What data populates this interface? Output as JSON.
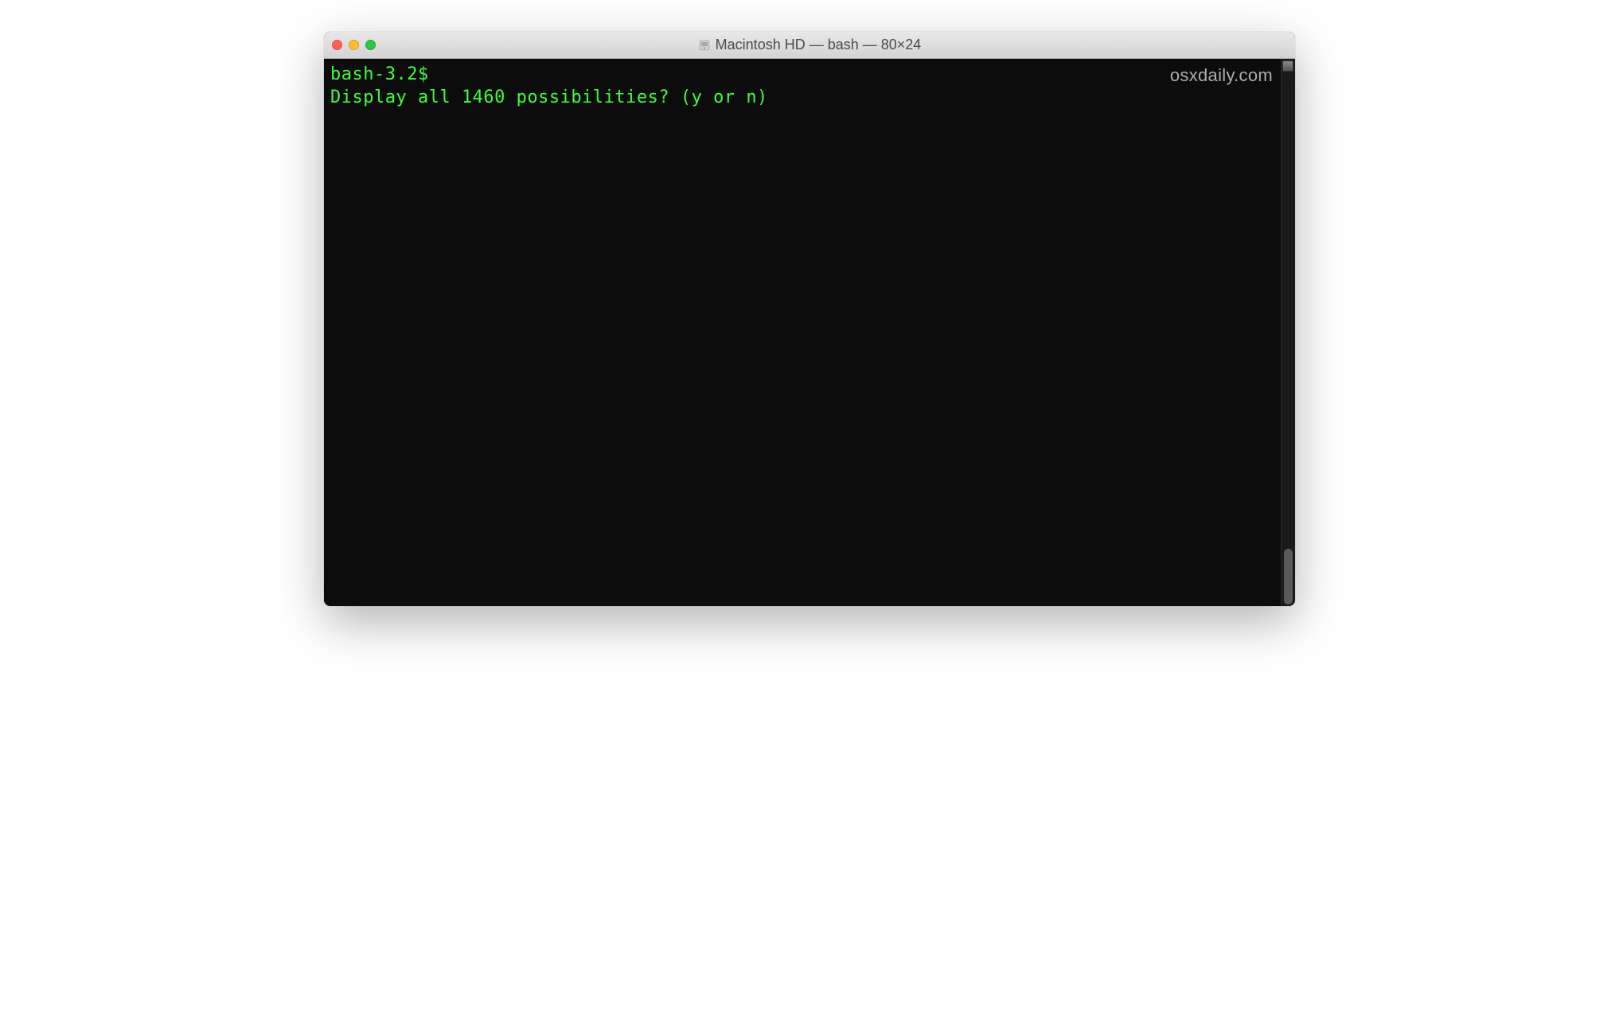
{
  "window": {
    "title": "Macintosh HD — bash — 80×24"
  },
  "terminal": {
    "prompt": "bash-3.2$ ",
    "output_line": "Display all 1460 possibilities? (y or n)",
    "text_color": "#3aff3a",
    "background_color": "#0c0c0c"
  },
  "watermark": "osxdaily.com"
}
